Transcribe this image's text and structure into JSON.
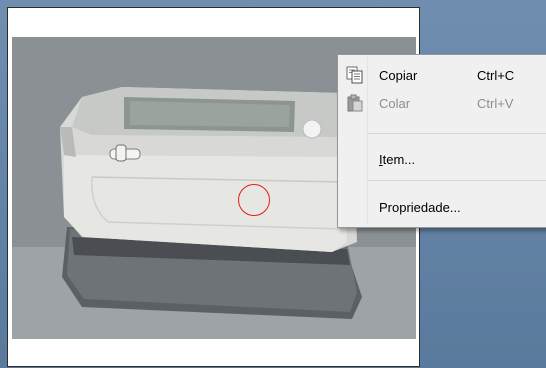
{
  "context_menu": {
    "items": [
      {
        "label": "Copiar",
        "shortcut": "Ctrl+C",
        "icon": "copy-icon",
        "enabled": true
      },
      {
        "label": "Colar",
        "shortcut": "Ctrl+V",
        "icon": "paste-icon",
        "enabled": false
      },
      {
        "label_mnemonic": "I",
        "label_rest": "tem...",
        "enabled": true
      },
      {
        "label": "Propriedade...",
        "enabled": true
      }
    ]
  },
  "colors": {
    "desktop": "#5b7a9c",
    "target_circle": "#e0201b",
    "menu_background": "#f0f0f0",
    "disabled_text": "#8e8e8e"
  }
}
